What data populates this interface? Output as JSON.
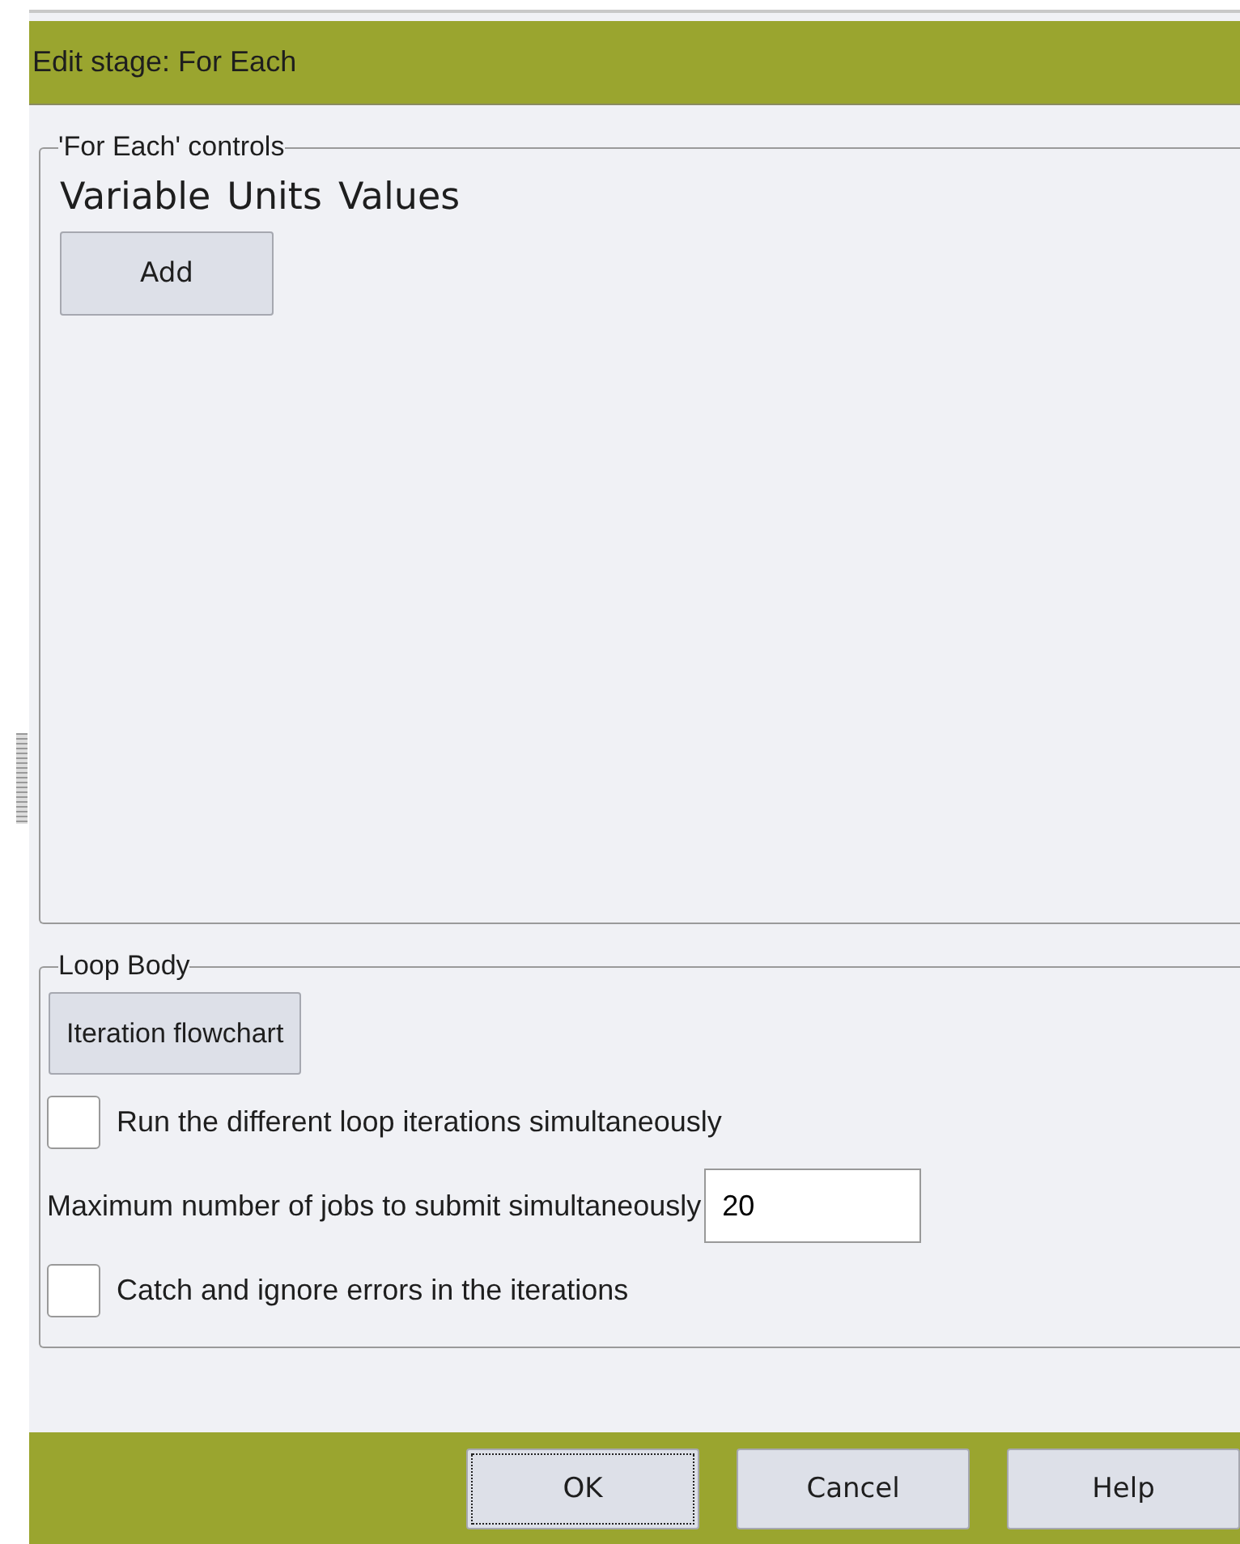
{
  "window": {
    "title": "Edit stage: For Each"
  },
  "for_each_controls": {
    "legend": "'For Each' controls",
    "headers": [
      "Variable",
      "Units",
      "Values"
    ],
    "add_button": "Add"
  },
  "loop_body": {
    "legend": "Loop Body",
    "flowchart_button": "Iteration flowchart",
    "rows": [
      {
        "kind": "checkbox",
        "label": "Run the different loop iterations simultaneously",
        "checked": false
      },
      {
        "kind": "number",
        "label": "Maximum number of jobs to submit simultaneously",
        "value": "20"
      },
      {
        "kind": "checkbox",
        "label": "Catch and ignore errors in the iterations",
        "checked": false
      }
    ]
  },
  "buttons": [
    {
      "label": "OK",
      "focused": true
    },
    {
      "label": "Cancel",
      "focused": false
    },
    {
      "label": "Help",
      "focused": false
    }
  ]
}
